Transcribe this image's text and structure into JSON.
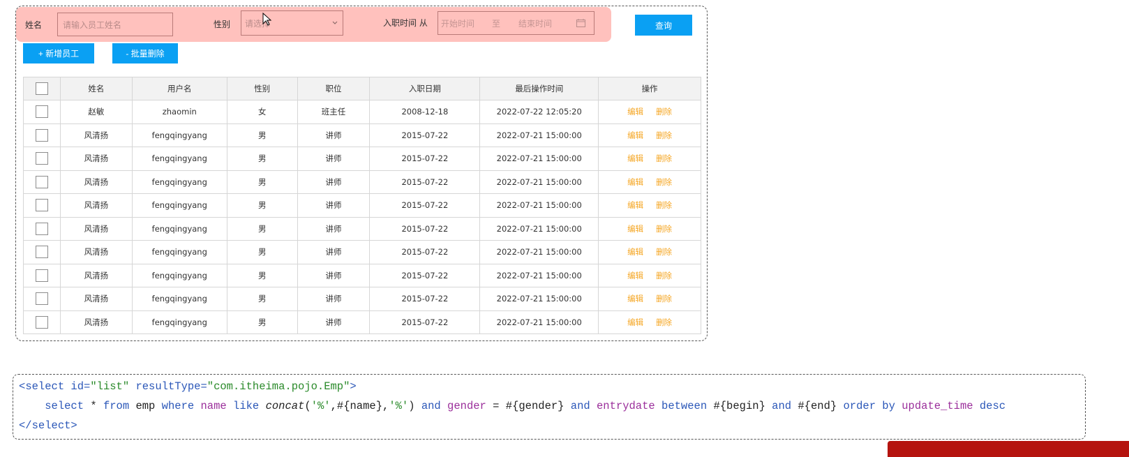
{
  "search": {
    "name_label": "姓名",
    "name_placeholder": "请输入员工姓名",
    "gender_label": "性别",
    "gender_placeholder": "请选择",
    "entry_label": "入职时间 从",
    "start_placeholder": "开始时间",
    "range_separator": "至",
    "end_placeholder": "结束时间",
    "query_button": "查询",
    "icons": {
      "select": "chevron-down-icon",
      "date": "calendar-icon"
    }
  },
  "toolbar": {
    "add_button": "+ 新增员工",
    "batch_delete_button": "- 批量删除"
  },
  "table": {
    "columns": [
      "",
      "姓名",
      "用户名",
      "性别",
      "职位",
      "入职日期",
      "最后操作时间",
      "操作"
    ],
    "action_labels": {
      "edit": "编辑",
      "delete": "删除"
    },
    "rows": [
      {
        "name": "赵敏",
        "username": "zhaomin",
        "gender": "女",
        "job": "班主任",
        "entry_date": "2008-12-18",
        "update_time": "2022-07-22 12:05:20"
      },
      {
        "name": "风清扬",
        "username": "fengqingyang",
        "gender": "男",
        "job": "讲师",
        "entry_date": "2015-07-22",
        "update_time": "2022-07-21 15:00:00"
      },
      {
        "name": "风清扬",
        "username": "fengqingyang",
        "gender": "男",
        "job": "讲师",
        "entry_date": "2015-07-22",
        "update_time": "2022-07-21 15:00:00"
      },
      {
        "name": "风清扬",
        "username": "fengqingyang",
        "gender": "男",
        "job": "讲师",
        "entry_date": "2015-07-22",
        "update_time": "2022-07-21 15:00:00"
      },
      {
        "name": "风清扬",
        "username": "fengqingyang",
        "gender": "男",
        "job": "讲师",
        "entry_date": "2015-07-22",
        "update_time": "2022-07-21 15:00:00"
      },
      {
        "name": "风清扬",
        "username": "fengqingyang",
        "gender": "男",
        "job": "讲师",
        "entry_date": "2015-07-22",
        "update_time": "2022-07-21 15:00:00"
      },
      {
        "name": "风清扬",
        "username": "fengqingyang",
        "gender": "男",
        "job": "讲师",
        "entry_date": "2015-07-22",
        "update_time": "2022-07-21 15:00:00"
      },
      {
        "name": "风清扬",
        "username": "fengqingyang",
        "gender": "男",
        "job": "讲师",
        "entry_date": "2015-07-22",
        "update_time": "2022-07-21 15:00:00"
      },
      {
        "name": "风清扬",
        "username": "fengqingyang",
        "gender": "男",
        "job": "讲师",
        "entry_date": "2015-07-22",
        "update_time": "2022-07-21 15:00:00"
      },
      {
        "name": "风清扬",
        "username": "fengqingyang",
        "gender": "男",
        "job": "讲师",
        "entry_date": "2015-07-22",
        "update_time": "2022-07-21 15:00:00"
      }
    ]
  },
  "code": {
    "line1": [
      {
        "t": "<",
        "c": "tag"
      },
      {
        "t": "select",
        "c": "tag"
      },
      {
        "t": " id=",
        "c": "kw"
      },
      {
        "t": "\"list\"",
        "c": "str"
      },
      {
        "t": " resultType=",
        "c": "kw"
      },
      {
        "t": "\"com.itheima.pojo.Emp\"",
        "c": "str"
      },
      {
        "t": ">",
        "c": "tag"
      }
    ],
    "line2": [
      {
        "t": "    ",
        "c": ""
      },
      {
        "t": "select",
        "c": "kw"
      },
      {
        "t": " * ",
        "c": ""
      },
      {
        "t": "from",
        "c": "kw"
      },
      {
        "t": " emp ",
        "c": ""
      },
      {
        "t": "where",
        "c": "kw"
      },
      {
        "t": " ",
        "c": ""
      },
      {
        "t": "name",
        "c": "fld"
      },
      {
        "t": " ",
        "c": ""
      },
      {
        "t": "like",
        "c": "kw"
      },
      {
        "t": " ",
        "c": ""
      },
      {
        "t": "concat",
        "c": "fn"
      },
      {
        "t": "(",
        "c": ""
      },
      {
        "t": "'%'",
        "c": "str"
      },
      {
        "t": ",#{name},",
        "c": ""
      },
      {
        "t": "'%'",
        "c": "str"
      },
      {
        "t": ") ",
        "c": ""
      },
      {
        "t": "and",
        "c": "kw"
      },
      {
        "t": " ",
        "c": ""
      },
      {
        "t": "gender",
        "c": "fld"
      },
      {
        "t": " = #{gender} ",
        "c": ""
      },
      {
        "t": "and",
        "c": "kw"
      },
      {
        "t": " ",
        "c": ""
      },
      {
        "t": "entrydate",
        "c": "fld"
      },
      {
        "t": " ",
        "c": ""
      },
      {
        "t": "between",
        "c": "kw"
      },
      {
        "t": " #{begin} ",
        "c": ""
      },
      {
        "t": "and",
        "c": "kw"
      },
      {
        "t": " #{end} ",
        "c": ""
      },
      {
        "t": "order by",
        "c": "kw"
      },
      {
        "t": " ",
        "c": ""
      },
      {
        "t": "update_time",
        "c": "fld"
      },
      {
        "t": " ",
        "c": ""
      },
      {
        "t": "desc",
        "c": "kw"
      }
    ],
    "line3": [
      {
        "t": "</",
        "c": "tag"
      },
      {
        "t": "select",
        "c": "tag"
      },
      {
        "t": ">",
        "c": "tag"
      }
    ]
  },
  "colors": {
    "search_bar_bg": "#ffc1bd",
    "primary_button": "#0aa0f3",
    "action_link": "#f5a623",
    "bottom_bar": "#b5140f"
  }
}
